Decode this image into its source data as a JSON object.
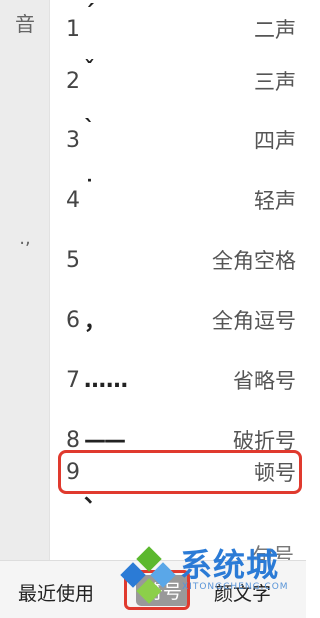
{
  "sidebar": {
    "top_label": "音",
    "mid_label": ".,"
  },
  "rows": [
    {
      "num": "1",
      "sym": "ˊ",
      "label": "二声"
    },
    {
      "num": "2",
      "sym": "ˇ",
      "label": "三声"
    },
    {
      "num": "3",
      "sym": "ˋ",
      "label": "四声"
    },
    {
      "num": "4",
      "sym": "˙",
      "label": "轻声"
    },
    {
      "num": "5",
      "sym": "",
      "label": "全角空格"
    },
    {
      "num": "6",
      "sym": "，",
      "label": "全角逗号"
    },
    {
      "num": "7",
      "sym": "……",
      "label": "省略号"
    },
    {
      "num": "8",
      "sym": "——",
      "label": "破折号"
    },
    {
      "num": "9",
      "sym": "、",
      "label": "顿号"
    }
  ],
  "partial_row_label": "句号",
  "bottom_tabs": {
    "recent": "最近使用",
    "symbol": "符号",
    "kaomoji": "颜文字"
  },
  "watermark": {
    "text": "系统城",
    "sub": "XITONGCHENG.COM"
  },
  "colors": {
    "highlight": "#e03a2e",
    "watermark_blue": "#2b7bd6",
    "watermark_green": "#5bb82e"
  }
}
